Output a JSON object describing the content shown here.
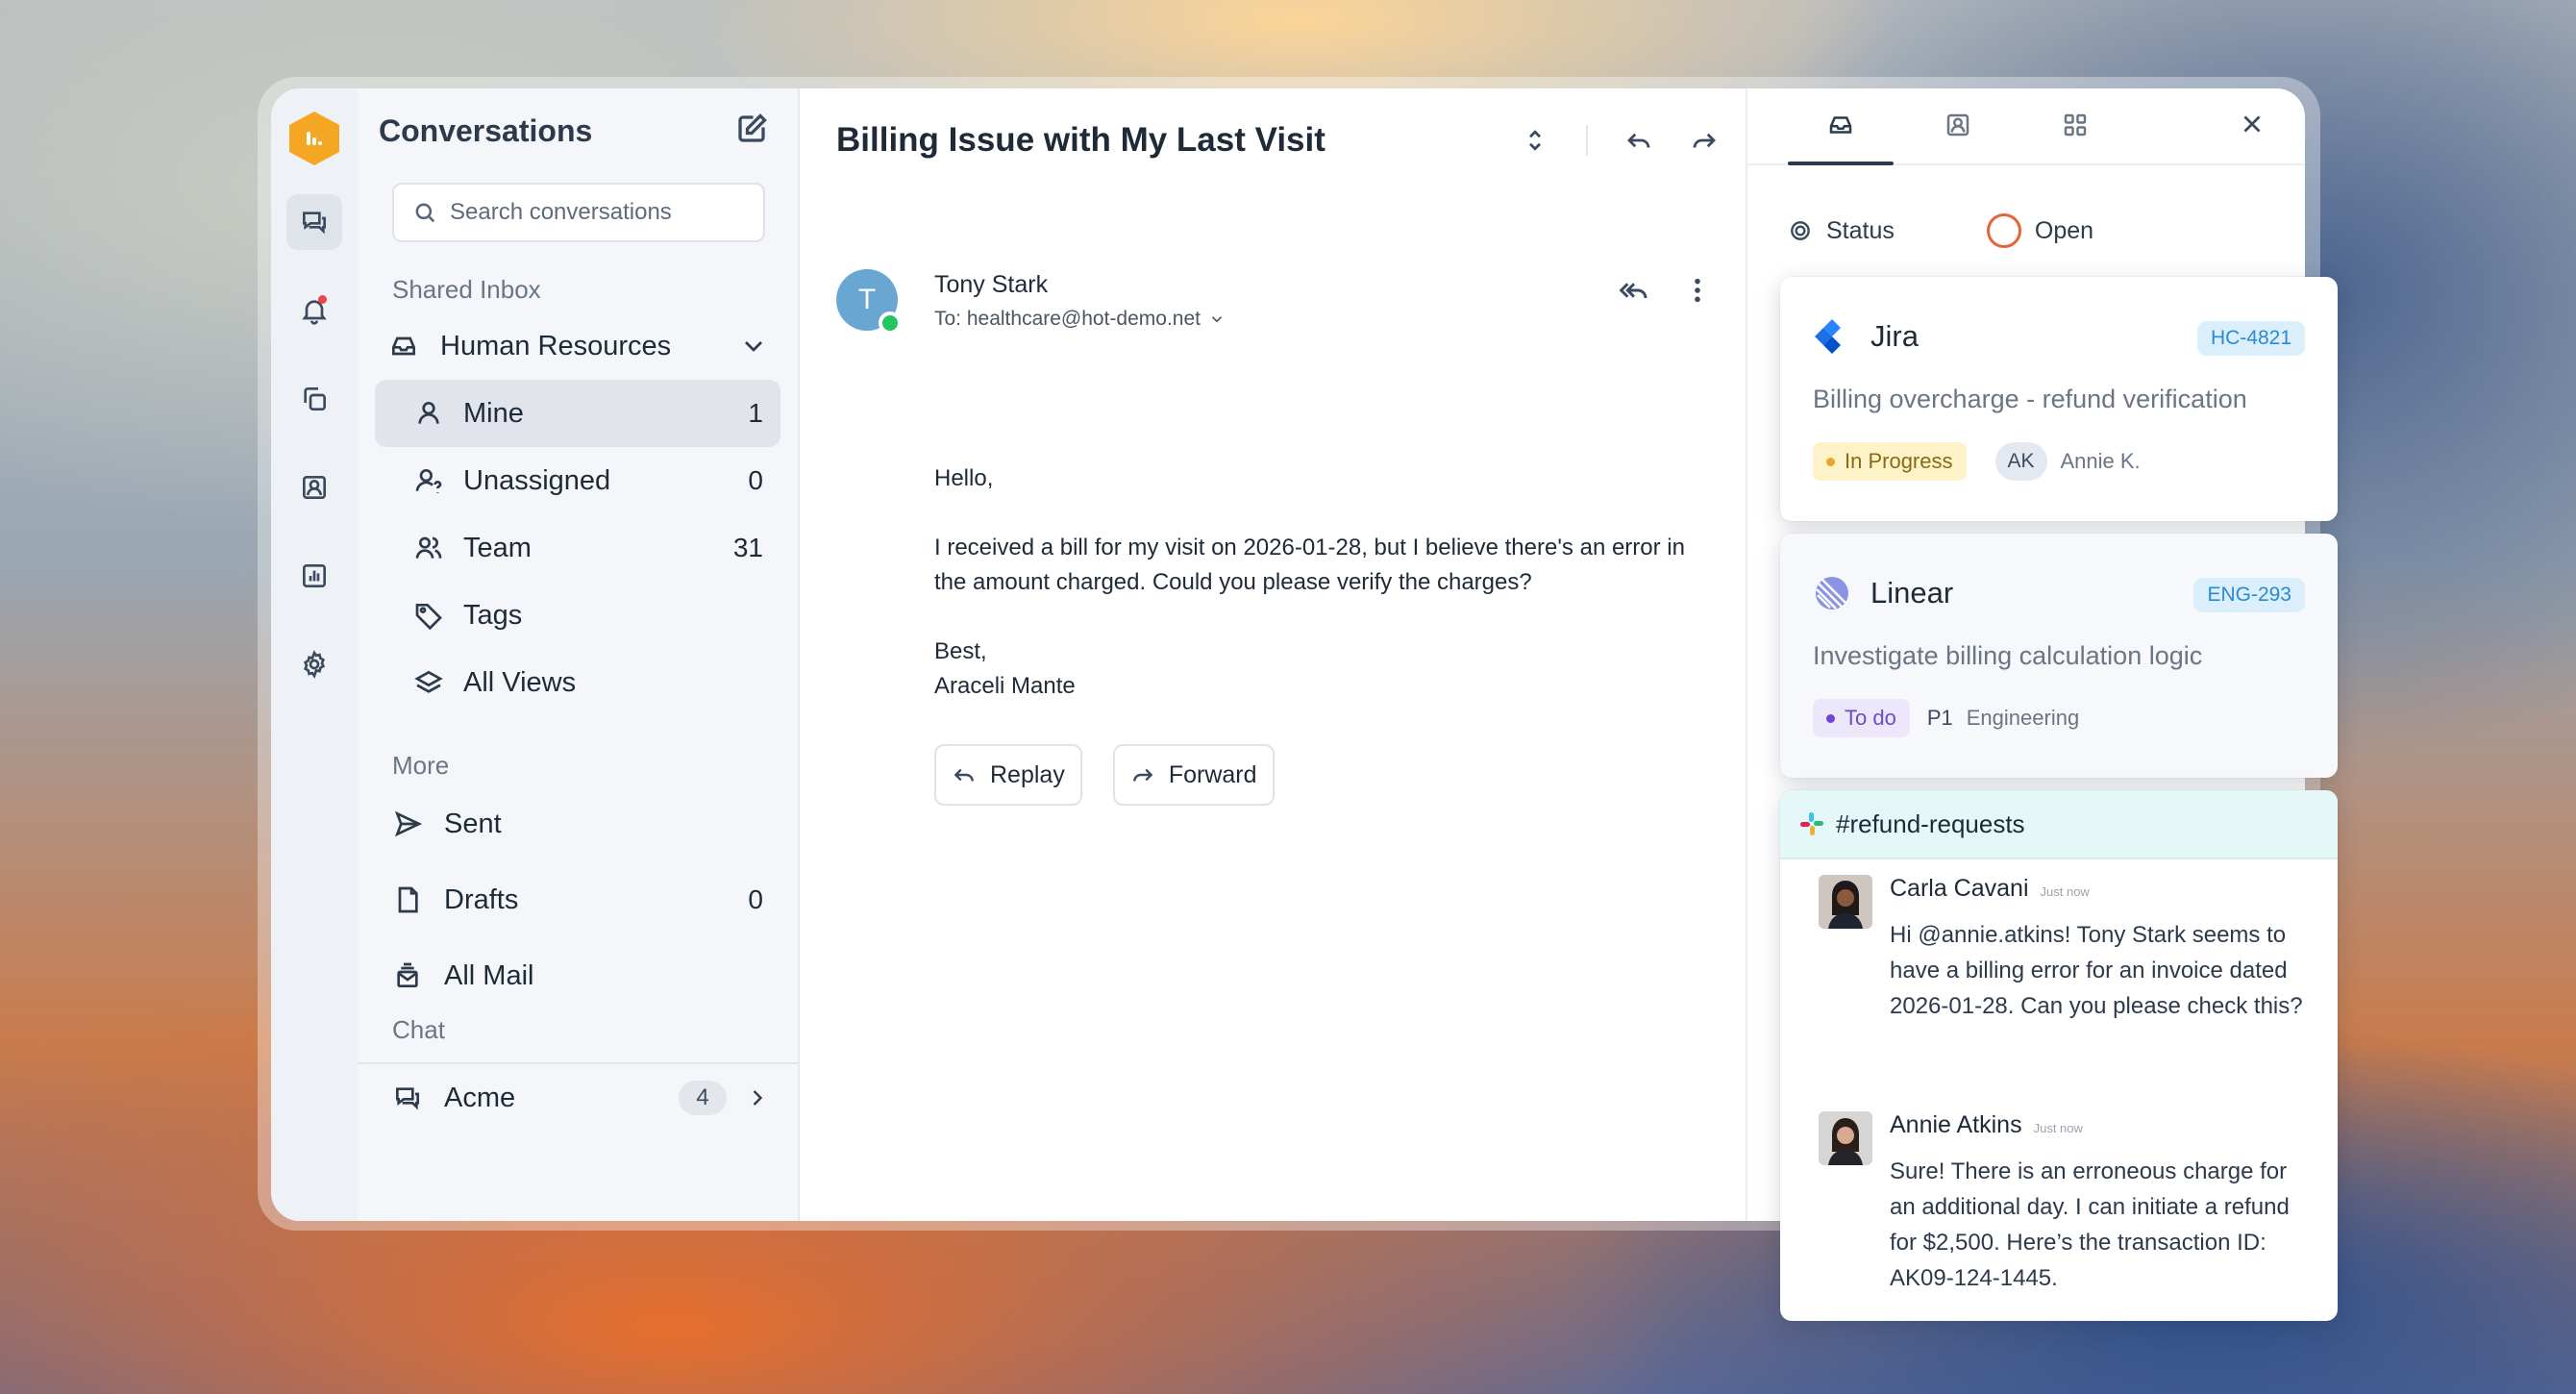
{
  "sidebar": {
    "title": "Conversations",
    "search_placeholder": "Search conversations",
    "shared_inbox_label": "Shared Inbox",
    "group": {
      "label": "Human Resources"
    },
    "items": [
      {
        "label": "Mine",
        "count": "1"
      },
      {
        "label": "Unassigned",
        "count": "0"
      },
      {
        "label": "Team",
        "count": "31"
      },
      {
        "label": "Tags",
        "count": ""
      },
      {
        "label": "All Views",
        "count": ""
      }
    ],
    "more_label": "More",
    "more_items": [
      {
        "label": "Sent",
        "count": ""
      },
      {
        "label": "Drafts",
        "count": "0"
      },
      {
        "label": "All Mail",
        "count": ""
      }
    ],
    "chat_label": "Chat",
    "chat_items": [
      {
        "label": "Acme",
        "count": "4"
      }
    ]
  },
  "conversation": {
    "subject": "Billing Issue with My Last Visit",
    "sender": {
      "initial": "T",
      "name": "Tony Stark",
      "to": "To: healthcare@hot-demo.net"
    },
    "body": [
      "Hello,",
      "I received a bill for my visit on 2026-01-28, but I believe there's an error in the amount charged. Could you please verify the charges?",
      "Best,",
      "Araceli Mante"
    ],
    "reply_label": "Replay",
    "forward_label": "Forward"
  },
  "details": {
    "status_label": "Status",
    "status_value": "Open"
  },
  "jira": {
    "tool": "Jira",
    "id": "HC-4821",
    "title": "Billing overcharge - refund verification",
    "state": "In Progress",
    "assignee_initials": "AK",
    "assignee": "Annie K."
  },
  "linear": {
    "tool": "Linear",
    "id": "ENG-293",
    "title": "Investigate billing calculation logic",
    "state": "To do",
    "priority": "P1",
    "team": "Engineering"
  },
  "slack": {
    "channel": "#refund-requests",
    "messages": [
      {
        "name": "Carla Cavani",
        "time": "Just now",
        "text": "Hi @annie.atkins! Tony Stark seems to have a billing error for an invoice dated 2026-01-28. Can you please check this?"
      },
      {
        "name": "Annie Atkins",
        "time": "Just now",
        "text": "Sure! There is an erroneous charge for an additional day. I can initiate a refund for $2,500. Here’s the transaction ID: AK09-124-1445."
      }
    ]
  },
  "colors": {
    "brand": "#f5a623",
    "status_open": "#e8613a",
    "jira": "#2684ff",
    "linear": "#5e6ad2",
    "online": "#22c55e"
  }
}
